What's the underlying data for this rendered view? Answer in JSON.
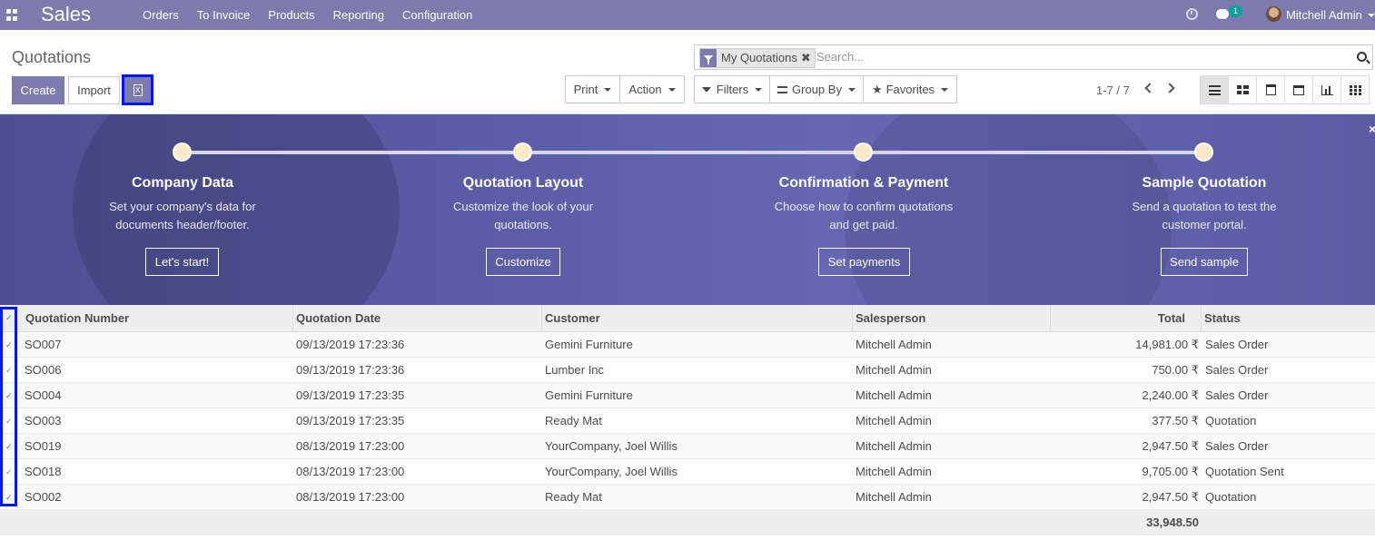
{
  "navbar": {
    "app_name": "Sales",
    "menu": [
      "Orders",
      "To Invoice",
      "Products",
      "Reporting",
      "Configuration"
    ],
    "chat_count": "1",
    "user_name": "Mitchell Admin"
  },
  "control_panel": {
    "breadcrumb": "Quotations",
    "create_label": "Create",
    "import_label": "Import",
    "xls_icon_glyph": "X",
    "print_label": "Print",
    "action_label": "Action",
    "filters_label": "Filters",
    "groupby_label": "Group By",
    "favorites_label": "Favorites",
    "facet_label": "My Quotations",
    "search_placeholder": "Search...",
    "pager": "1-7 / 7"
  },
  "banner": {
    "steps": [
      {
        "title": "Company Data",
        "desc1": "Set your company's data for",
        "desc2": "documents header/footer.",
        "button": "Let's start!"
      },
      {
        "title": "Quotation Layout",
        "desc1": "Customize the look of your",
        "desc2": "quotations.",
        "button": "Customize"
      },
      {
        "title": "Confirmation & Payment",
        "desc1": "Choose how to confirm quotations",
        "desc2": "and get paid.",
        "button": "Set payments"
      },
      {
        "title": "Sample Quotation",
        "desc1": "Send a quotation to test the",
        "desc2": "customer portal.",
        "button": "Send sample"
      }
    ],
    "close_glyph": "×"
  },
  "table": {
    "headers": [
      "Quotation Number",
      "Quotation Date",
      "Customer",
      "Salesperson",
      "Total",
      "Status"
    ],
    "rows": [
      {
        "number": "SO007",
        "date": "09/13/2019 17:23:36",
        "customer": "Gemini Furniture",
        "salesperson": "Mitchell Admin",
        "total": "14,981.00 ₹",
        "status": "Sales Order"
      },
      {
        "number": "SO006",
        "date": "09/13/2019 17:23:36",
        "customer": "Lumber Inc",
        "salesperson": "Mitchell Admin",
        "total": "750.00 ₹",
        "status": "Sales Order"
      },
      {
        "number": "SO004",
        "date": "09/13/2019 17:23:35",
        "customer": "Gemini Furniture",
        "salesperson": "Mitchell Admin",
        "total": "2,240.00 ₹",
        "status": "Sales Order"
      },
      {
        "number": "SO003",
        "date": "09/13/2019 17:23:35",
        "customer": "Ready Mat",
        "salesperson": "Mitchell Admin",
        "total": "377.50 ₹",
        "status": "Quotation"
      },
      {
        "number": "SO019",
        "date": "08/13/2019 17:23:00",
        "customer": "YourCompany, Joel Willis",
        "salesperson": "Mitchell Admin",
        "total": "2,947.50 ₹",
        "status": "Sales Order"
      },
      {
        "number": "SO018",
        "date": "08/13/2019 17:23:00",
        "customer": "YourCompany, Joel Willis",
        "salesperson": "Mitchell Admin",
        "total": "9,705.00 ₹",
        "status": "Quotation Sent"
      },
      {
        "number": "SO002",
        "date": "08/13/2019 17:23:00",
        "customer": "Ready Mat",
        "salesperson": "Mitchell Admin",
        "total": "2,947.50 ₹",
        "status": "Quotation"
      }
    ],
    "sum_total": "33,948.50",
    "check_glyph": "✓"
  }
}
